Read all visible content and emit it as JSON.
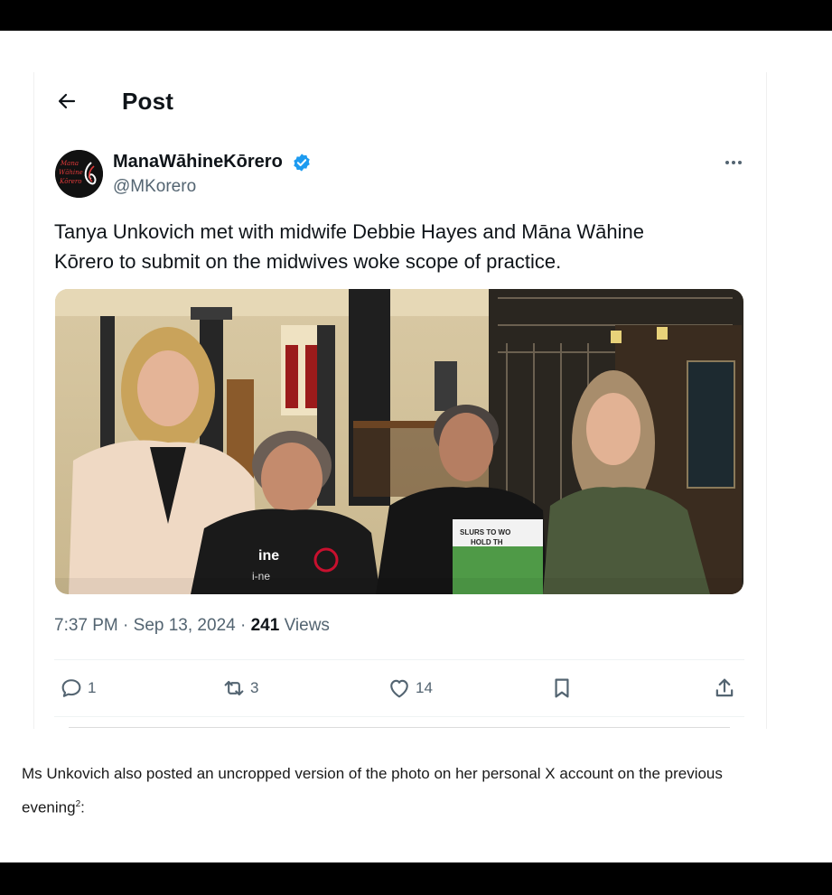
{
  "header": {
    "title": "Post",
    "back_icon": "arrow-left-icon"
  },
  "author": {
    "display_name": "ManaWāhineKōrero",
    "handle": "@MKorero",
    "avatar_text": [
      "Mana",
      "Wāhine",
      "Kōrero"
    ],
    "verified": true,
    "verified_color": "#1d9bf0"
  },
  "tweet": {
    "text_line1": "Tanya Unkovich met with midwife  Debbie Hayes and Māna Wāhine",
    "text_line2": "Kōrero to submit on the midwives woke  scope of practice.",
    "photo_texts": {
      "shirt_word": "ine",
      "shirt_word2": "i-ne",
      "sign_line1": "SLURS TO WO",
      "sign_line2": "HOLD TH"
    }
  },
  "meta": {
    "time": "7:37 PM",
    "separator": " · ",
    "date": "Sep 13, 2024",
    "views_count": "241",
    "views_label": " Views"
  },
  "actions": {
    "replies": "1",
    "reposts": "3",
    "likes": "14"
  },
  "caption": {
    "text": "Ms Unkovich also posted an uncropped version of the photo on her personal X account on the previous",
    "text2": "evening",
    "footnote": "2",
    "tail": ":"
  },
  "colors": {
    "accent": "#1d9bf0",
    "secondary_text": "#536471",
    "brand_red": "#c8102e"
  }
}
